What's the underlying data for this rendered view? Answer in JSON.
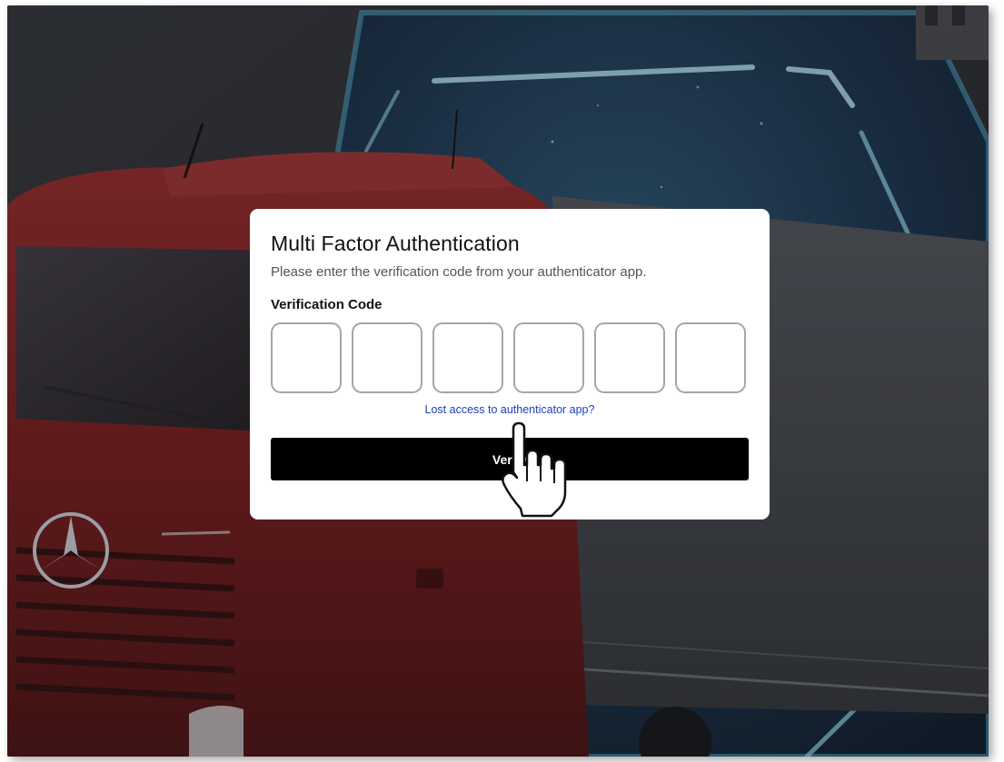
{
  "dialog": {
    "title": "Multi Factor Authentication",
    "subtitle": "Please enter the verification code from your authenticator app.",
    "code_label": "Verification Code",
    "code_digits": [
      "",
      "",
      "",
      "",
      "",
      ""
    ],
    "lost_access_link": "Lost access to authenticator app?",
    "verify_button": "Verify"
  },
  "colors": {
    "link": "#1a3fb8",
    "button_bg": "#000000",
    "card_bg": "#ffffff",
    "neon_frame": "#5fd3ff",
    "truck_red": "#8c1e1e"
  },
  "icons": {
    "cursor": "hand-pointer-icon",
    "vehicle_logo": "mercedes-star-icon"
  }
}
